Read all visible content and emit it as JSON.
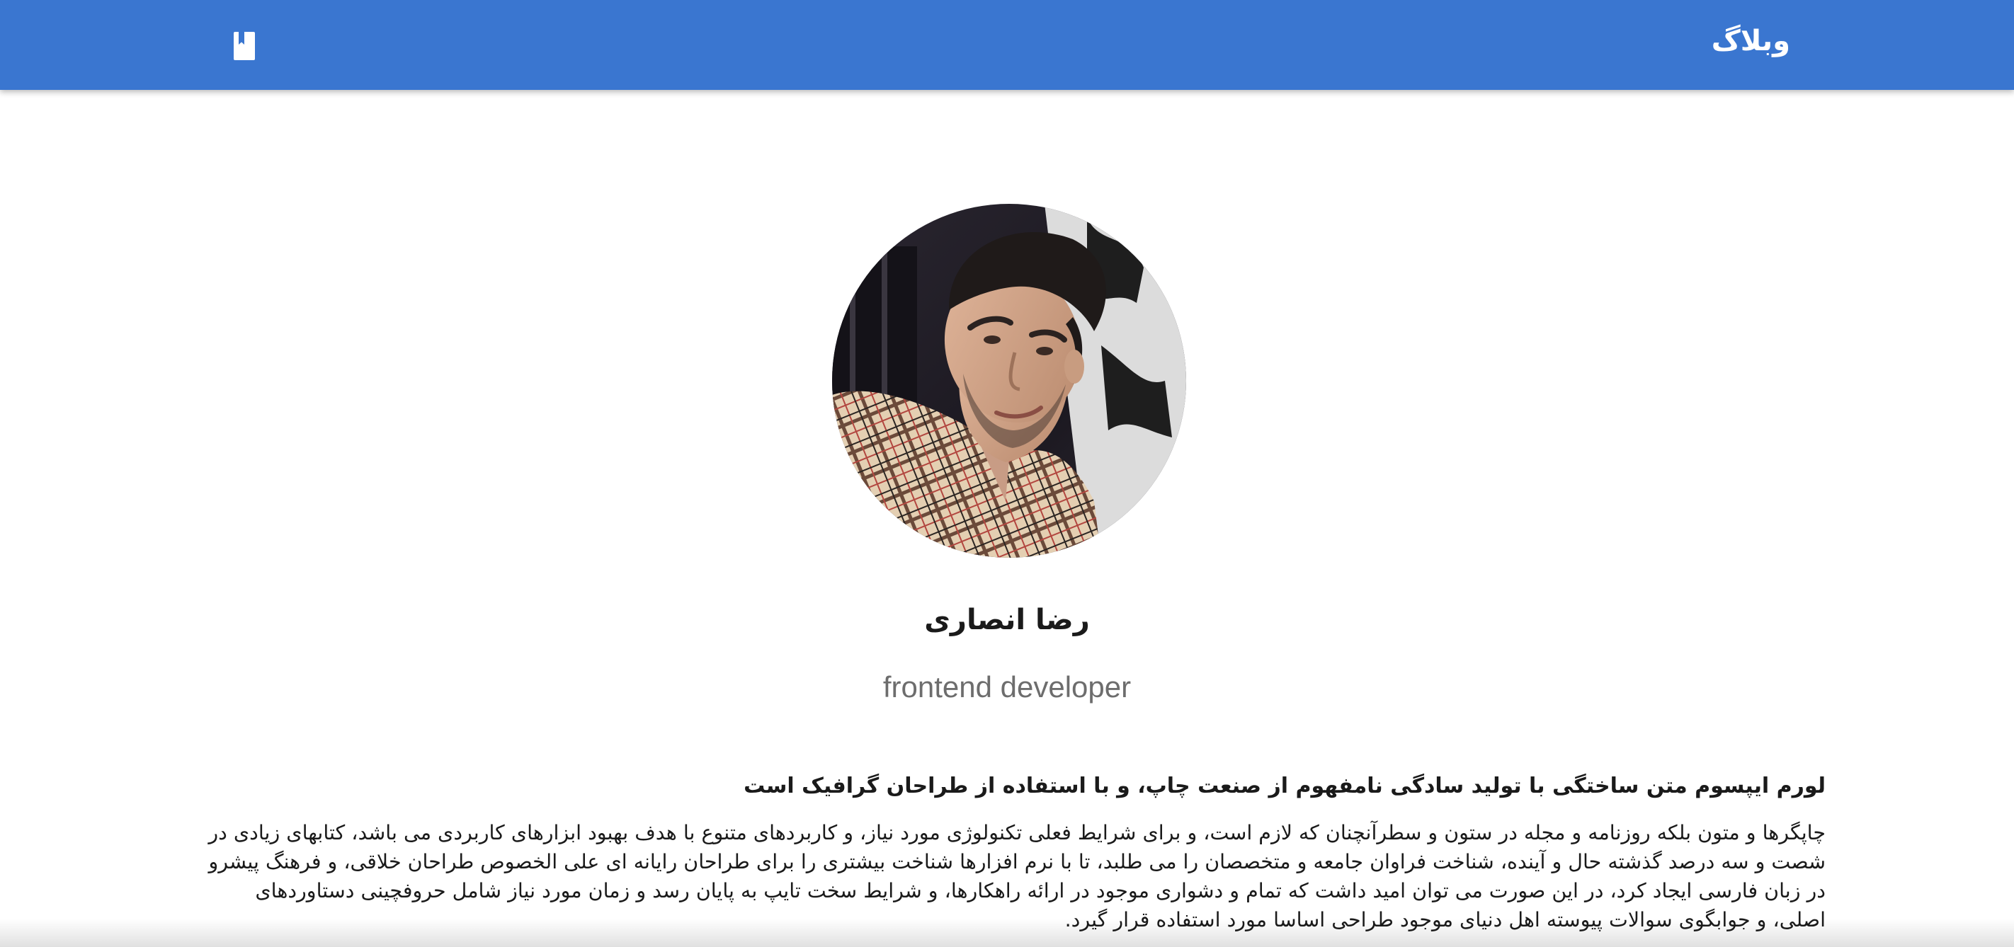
{
  "appbar": {
    "brand": "وبلاگ",
    "icon": "book-icon",
    "color": "#3a76d0"
  },
  "profile": {
    "avatar_icon": "profile-photo",
    "name": "رضا انصاری",
    "role": "frontend developer"
  },
  "article": {
    "lead": "لورم ایپسوم متن ساختگی با تولید سادگی نامفهوم از صنعت چاپ، و با استفاده از طراحان گرافیک است",
    "body": "چاپگرها و متون بلکه روزنامه و مجله در ستون و سطرآنچنان که لازم است، و برای شرایط فعلی تکنولوژی مورد نیاز، و کاربردهای متنوع با هدف بهبود ابزارهای کاربردی می باشد، کتابهای زیادی در شصت و سه درصد گذشته حال و آینده، شناخت فراوان جامعه و متخصصان را می طلبد، تا با نرم افزارها شناخت بیشتری را برای طراحان رایانه ای علی الخصوص طراحان خلاقی، و فرهنگ پیشرو در زبان فارسی ایجاد کرد، در این صورت می توان امید داشت که تمام و دشواری موجود در ارائه راهکارها، و شرایط سخت تایپ به پایان رسد و زمان مورد نیاز شامل حروفچینی دستاوردهای اصلی، و جوابگوی سوالات پیوسته اهل دنیای موجود طراحی اساسا مورد استفاده قرار گیرد."
  }
}
